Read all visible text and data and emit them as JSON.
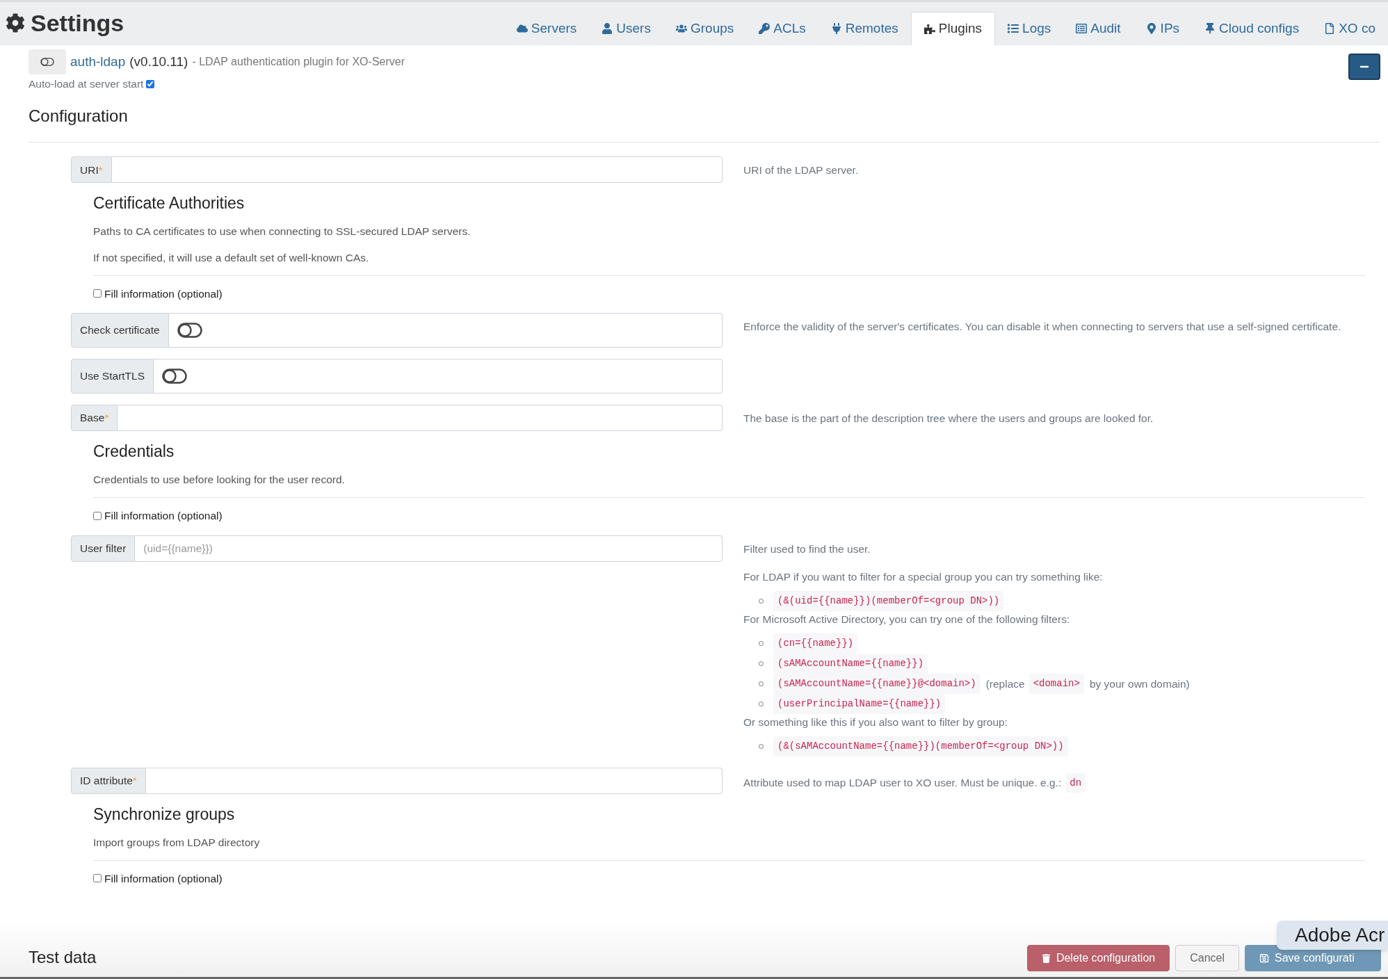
{
  "header": {
    "title": "Settings"
  },
  "tabs": [
    {
      "label": "Servers",
      "selected": false
    },
    {
      "label": "Users",
      "selected": false
    },
    {
      "label": "Groups",
      "selected": false
    },
    {
      "label": "ACLs",
      "selected": false
    },
    {
      "label": "Remotes",
      "selected": false
    },
    {
      "label": "Plugins",
      "selected": true
    },
    {
      "label": "Logs",
      "selected": false
    },
    {
      "label": "Audit",
      "selected": false
    },
    {
      "label": "IPs",
      "selected": false
    },
    {
      "label": "Cloud configs",
      "selected": false
    },
    {
      "label": "XO co",
      "selected": false
    }
  ],
  "plugin": {
    "name": "auth-ldap",
    "version": "(v0.10.11)",
    "description": "- LDAP authentication plugin for XO-Server",
    "autoload_label": "Auto-load at server start",
    "autoload": true,
    "expanded": true,
    "enabled": false
  },
  "configuration_title": "Configuration",
  "form": [
    {
      "kind": "field",
      "label": "URI",
      "required_mark": "*",
      "description": [
        {
          "kind": "text",
          "segments": [
            {
              "kind": "text",
              "text": "URI of the LDAP server."
            }
          ]
        }
      ]
    },
    {
      "kind": "group",
      "title": "Certificate Authorities",
      "lines": [
        "Paths to CA certificates to use when connecting to SSL-secured LDAP servers.",
        "If not specified, it will use a default set of well-known CAs."
      ],
      "fill_label": "Fill information (optional)",
      "fill_checked": false
    },
    {
      "kind": "toggle",
      "label": "Check certificate",
      "on": false,
      "description": [
        {
          "kind": "text",
          "segments": [
            {
              "kind": "text",
              "text": "Enforce the validity of the server's certificates. You can disable it when connecting to servers that use a self-signed certificate."
            }
          ]
        }
      ]
    },
    {
      "kind": "toggle",
      "label": "Use StartTLS",
      "on": false
    },
    {
      "kind": "field",
      "label": "Base",
      "required_mark": "*",
      "description": [
        {
          "kind": "text",
          "segments": [
            {
              "kind": "text",
              "text": "The base is the part of the description tree where the users and groups are looked for."
            }
          ]
        }
      ]
    },
    {
      "kind": "group",
      "title": "Credentials",
      "lines": [
        "Credentials to use before looking for the user record."
      ],
      "fill_label": "Fill information (optional)",
      "fill_checked": false
    },
    {
      "kind": "field",
      "label": "User filter",
      "placeholder": "(uid={{name}})",
      "description": [
        {
          "kind": "text",
          "segments": [
            {
              "kind": "text",
              "text": "Filter used to find the user."
            }
          ]
        },
        {
          "kind": "text",
          "segments": [
            {
              "kind": "text",
              "text": "For LDAP if you want to filter for a special group you can try something like:"
            }
          ]
        },
        {
          "kind": "list",
          "items": [
            [
              {
                "kind": "code",
                "text": "(&(uid={{name}})(memberOf=<group DN>))"
              }
            ]
          ]
        },
        {
          "kind": "text",
          "segments": [
            {
              "kind": "text",
              "text": "For Microsoft Active Directory, you can try one of the following filters:"
            }
          ]
        },
        {
          "kind": "list",
          "items": [
            [
              {
                "kind": "code",
                "text": "(cn={{name}})"
              }
            ],
            [
              {
                "kind": "code",
                "text": "(sAMAccountName={{name}})"
              }
            ],
            [
              {
                "kind": "code",
                "text": "(sAMAccountName={{name}}@<domain>)"
              },
              {
                "kind": "text",
                "text": "(replace"
              },
              {
                "kind": "code",
                "text": "<domain>"
              },
              {
                "kind": "text",
                "text": "by your own domain)"
              }
            ],
            [
              {
                "kind": "code",
                "text": "(userPrincipalName={{name}})"
              }
            ]
          ]
        },
        {
          "kind": "text",
          "segments": [
            {
              "kind": "text",
              "text": "Or something like this if you also want to filter by group:"
            }
          ]
        },
        {
          "kind": "list",
          "items": [
            [
              {
                "kind": "code",
                "text": "(&(sAMAccountName={{name}})(memberOf=<group DN>))"
              }
            ]
          ]
        }
      ]
    },
    {
      "kind": "field",
      "label": "ID attribute",
      "required_mark": "*",
      "description": [
        {
          "kind": "text",
          "segments": [
            {
              "kind": "text",
              "text": "Attribute used to map LDAP user to XO user. Must be unique. e.g.:"
            },
            {
              "kind": "code",
              "text": "dn"
            }
          ]
        }
      ]
    },
    {
      "kind": "group",
      "title": "Synchronize groups",
      "lines": [
        "Import groups from LDAP directory"
      ],
      "fill_label": "Fill information (optional)",
      "fill_checked": false
    }
  ],
  "test_data_title": "Test data",
  "buttons": [
    {
      "kind": "danger",
      "label": "Delete configuration"
    },
    {
      "kind": "plain",
      "label": "Cancel"
    },
    {
      "kind": "primary",
      "label": "Save configurati"
    }
  ],
  "tooltip": "Adobe Acr"
}
